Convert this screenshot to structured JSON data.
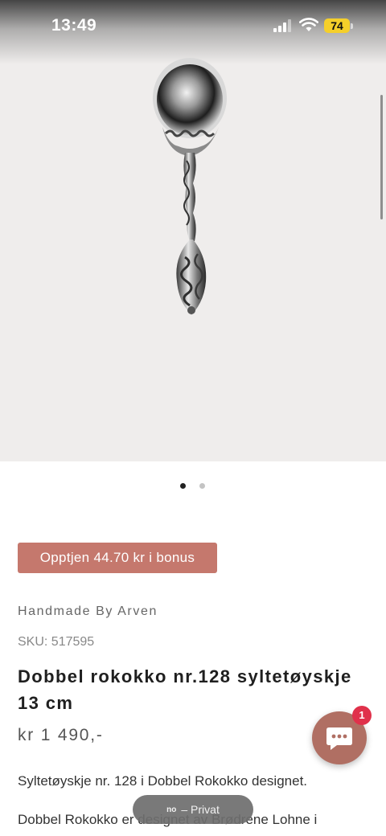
{
  "status_bar": {
    "time": "13:49",
    "battery": "74",
    "battery_color": "#f5cf2a"
  },
  "gallery": {
    "image_icon": "spoon-product-image",
    "dots_count": 2,
    "active_dot": 0
  },
  "product": {
    "bonus_label": "Opptjen 44.70 kr i bonus",
    "vendor": "Handmade By Arven",
    "sku": "SKU: 517595",
    "title": "Dobbel rokokko nr.128 syltetøyskje 13 cm",
    "price": "kr 1 490,-",
    "description_line1": "Syltetøyskje nr. 128 i Dobbel Rokokko designet.",
    "description_line2": "Dobbel Rokokko er designet av Brødrene Lohne i"
  },
  "chat": {
    "icon": "chat-bubble-icon",
    "badge_count": "1",
    "accent": "#b06f63"
  },
  "browser": {
    "private_prefix": "no",
    "private_label": "– Privat"
  },
  "colors": {
    "bonus_bg": "#c5786d",
    "badge": "#e0314b"
  }
}
